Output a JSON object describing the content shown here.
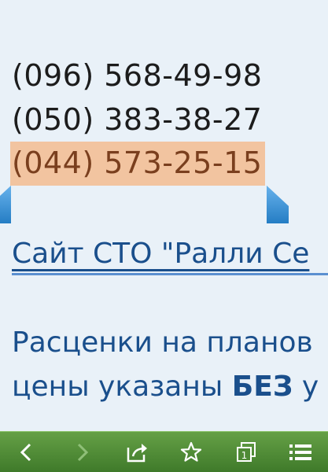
{
  "phones": [
    "(096) 568-49-98",
    "(050) 383-38-27",
    "(044) 573-25-15"
  ],
  "link_text": "Сайт СТО \"Ралли Се",
  "paragraph_line1": "Расценки на планов",
  "paragraph_line2_prefix": "цены указаны ",
  "paragraph_line2_bold": "БЕЗ",
  "paragraph_line2_suffix": " у",
  "toolbar": {
    "icons": [
      "back-arrow-icon",
      "forward-arrow-icon",
      "share-icon",
      "bookmark-star-icon",
      "tabs-icon",
      "menu-icon"
    ],
    "tabs_count": "1"
  },
  "colors": {
    "background": "#e9f1f8",
    "selection": "#f2c4a0",
    "link": "#1a4f8c",
    "toolbar": "#4f8a36",
    "handle": "#2f8fd8"
  }
}
